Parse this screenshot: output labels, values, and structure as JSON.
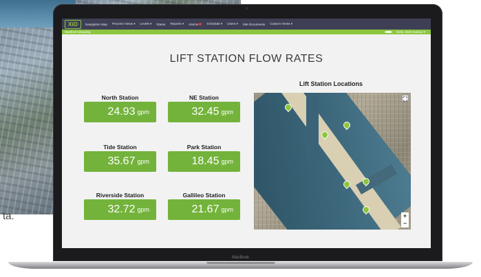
{
  "nav": {
    "logo": "XiO",
    "items": [
      "Navigation Map",
      "Process Views ▾",
      "Levels ▾",
      "Status",
      "Reports ▾",
      "Alarms",
      "Schedule ▾",
      "Users ▾",
      "Site Documents",
      "Custom Views ▾"
    ]
  },
  "subbar": {
    "left": "Stanford Unloading",
    "right": "Hello, Mark Hudson ▾"
  },
  "page": {
    "title": "LIFT STATION FLOW RATES"
  },
  "stations": [
    {
      "name": "North Station",
      "value": "24.93",
      "unit": "gpm"
    },
    {
      "name": "NE Station",
      "value": "32.45",
      "unit": "gpm"
    },
    {
      "name": "Tide Station",
      "value": "35.67",
      "unit": "gpm"
    },
    {
      "name": "Park Station",
      "value": "18.45",
      "unit": "gpm"
    },
    {
      "name": "Riverside Station",
      "value": "32.72",
      "unit": "gpm"
    },
    {
      "name": "Gallileo Station",
      "value": "21.67",
      "unit": "gpm"
    }
  ],
  "map": {
    "title": "Lift Station Locations",
    "zoom_in": "+",
    "zoom_out": "−",
    "fullscreen": "⛶"
  },
  "background": {
    "stray_text": "ta."
  },
  "device": {
    "brand": "MacBook"
  },
  "colors": {
    "nav": "#3e3f54",
    "accent_green": "#8cc63f",
    "tile_green": "#73b33b"
  }
}
